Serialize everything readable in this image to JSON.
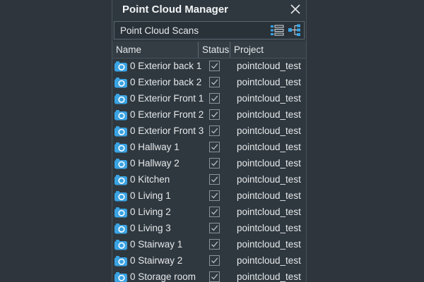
{
  "window": {
    "title": "Point Cloud Manager"
  },
  "toolbar": {
    "label": "Point Cloud Scans",
    "list_view_icon": "list-view-icon",
    "tree_view_icon": "tree-view-icon"
  },
  "table": {
    "columns": {
      "name": "Name",
      "status": "Status",
      "project": "Project"
    },
    "rows": [
      {
        "name": "0 Exterior back 1",
        "checked": true,
        "project": "pointcloud_test"
      },
      {
        "name": "0 Exterior back 2",
        "checked": true,
        "project": "pointcloud_test"
      },
      {
        "name": "0 Exterior Front 1",
        "checked": true,
        "project": "pointcloud_test"
      },
      {
        "name": "0 Exterior Front 2",
        "checked": true,
        "project": "pointcloud_test"
      },
      {
        "name": "0 Exterior Front 3",
        "checked": true,
        "project": "pointcloud_test"
      },
      {
        "name": "0 Hallway 1",
        "checked": true,
        "project": "pointcloud_test"
      },
      {
        "name": "0 Hallway 2",
        "checked": true,
        "project": "pointcloud_test"
      },
      {
        "name": "0 Kitchen",
        "checked": true,
        "project": "pointcloud_test"
      },
      {
        "name": "0 Living 1",
        "checked": true,
        "project": "pointcloud_test"
      },
      {
        "name": "0 Living 2",
        "checked": true,
        "project": "pointcloud_test"
      },
      {
        "name": "0 Living 3",
        "checked": true,
        "project": "pointcloud_test"
      },
      {
        "name": "0 Stairway 1",
        "checked": true,
        "project": "pointcloud_test"
      },
      {
        "name": "0 Stairway 2",
        "checked": true,
        "project": "pointcloud_test"
      },
      {
        "name": "0 Storage room",
        "checked": true,
        "project": "pointcloud_test"
      }
    ]
  },
  "colors": {
    "accent_icon": "#3aa3e3",
    "background": "#2e353d",
    "panel": "#2f383f"
  }
}
